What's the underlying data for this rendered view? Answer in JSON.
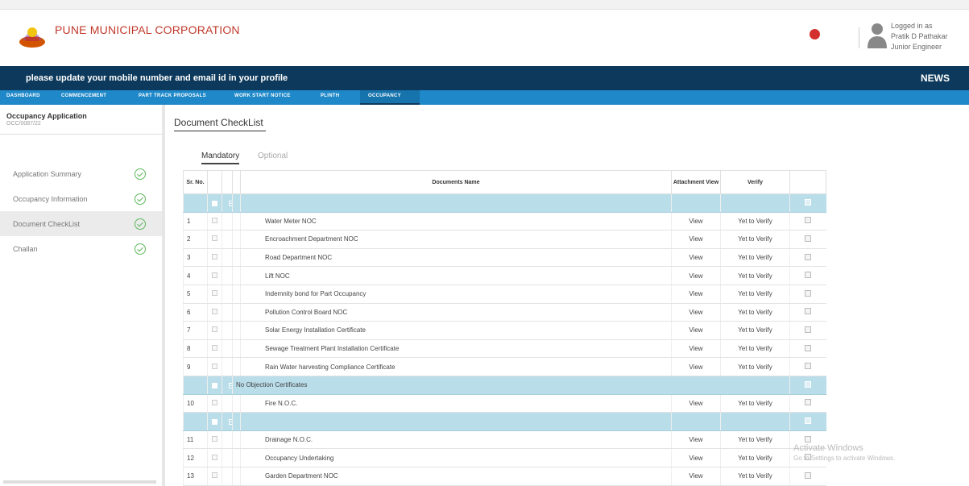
{
  "header": {
    "brand": "PUNE MUNICIPAL CORPORATION",
    "user": {
      "logged_in_as": "Logged in as",
      "name": "Pratik D Pathakar",
      "role": "Junior Engineer"
    }
  },
  "notice": {
    "text": "please update your mobile number and email id in your profile",
    "news": "NEWS"
  },
  "tabs": [
    "DASHBOARD",
    "COMMENCEMENT",
    "PART TRACK PROPOSALS",
    "WORK START NOTICE",
    "PLINTH",
    "OCCUPANCY"
  ],
  "sidebar": {
    "title": "Occupancy Application",
    "subtitle": "OCC/0087/22",
    "items": [
      {
        "label": "Application Summary"
      },
      {
        "label": "Occupancy Information"
      },
      {
        "label": "Document CheckList"
      },
      {
        "label": "Challan"
      }
    ]
  },
  "main": {
    "title": "Document CheckList",
    "subtabs": {
      "mandatory": "Mandatory",
      "optional": "Optional"
    }
  },
  "table": {
    "headers": {
      "sr": "Sr. No.",
      "name": "Documents Name",
      "attachment": "Attachment View",
      "verify": "Verify"
    },
    "view_label": "View",
    "verify_label": "Yet to Verify",
    "group_nocs": "No Objection Certificates",
    "rows_a": [
      {
        "sr": "1",
        "name": "Water Meter NOC"
      },
      {
        "sr": "2",
        "name": "Encroachment Department NOC"
      },
      {
        "sr": "3",
        "name": "Road Department NOC"
      },
      {
        "sr": "4",
        "name": "Lift NOC"
      },
      {
        "sr": "5",
        "name": "Indemnity bond for Part Occupancy"
      },
      {
        "sr": "6",
        "name": "Pollution Control Board NOC"
      },
      {
        "sr": "7",
        "name": "Solar Energy Installation Certificate"
      },
      {
        "sr": "8",
        "name": "Sewage Treatment Plant Installation Certificate"
      },
      {
        "sr": "9",
        "name": "Rain Water harvesting Compliance Certificate"
      }
    ],
    "rows_b": [
      {
        "sr": "10",
        "name": "Fire N.O.C."
      }
    ],
    "rows_c": [
      {
        "sr": "11",
        "name": "Drainage N.O.C."
      },
      {
        "sr": "12",
        "name": "Occupancy Undertaking"
      },
      {
        "sr": "13",
        "name": "Garden Department NOC"
      }
    ]
  },
  "watermark": {
    "title": "Activate Windows",
    "sub": "Go to Settings to activate Windows."
  }
}
